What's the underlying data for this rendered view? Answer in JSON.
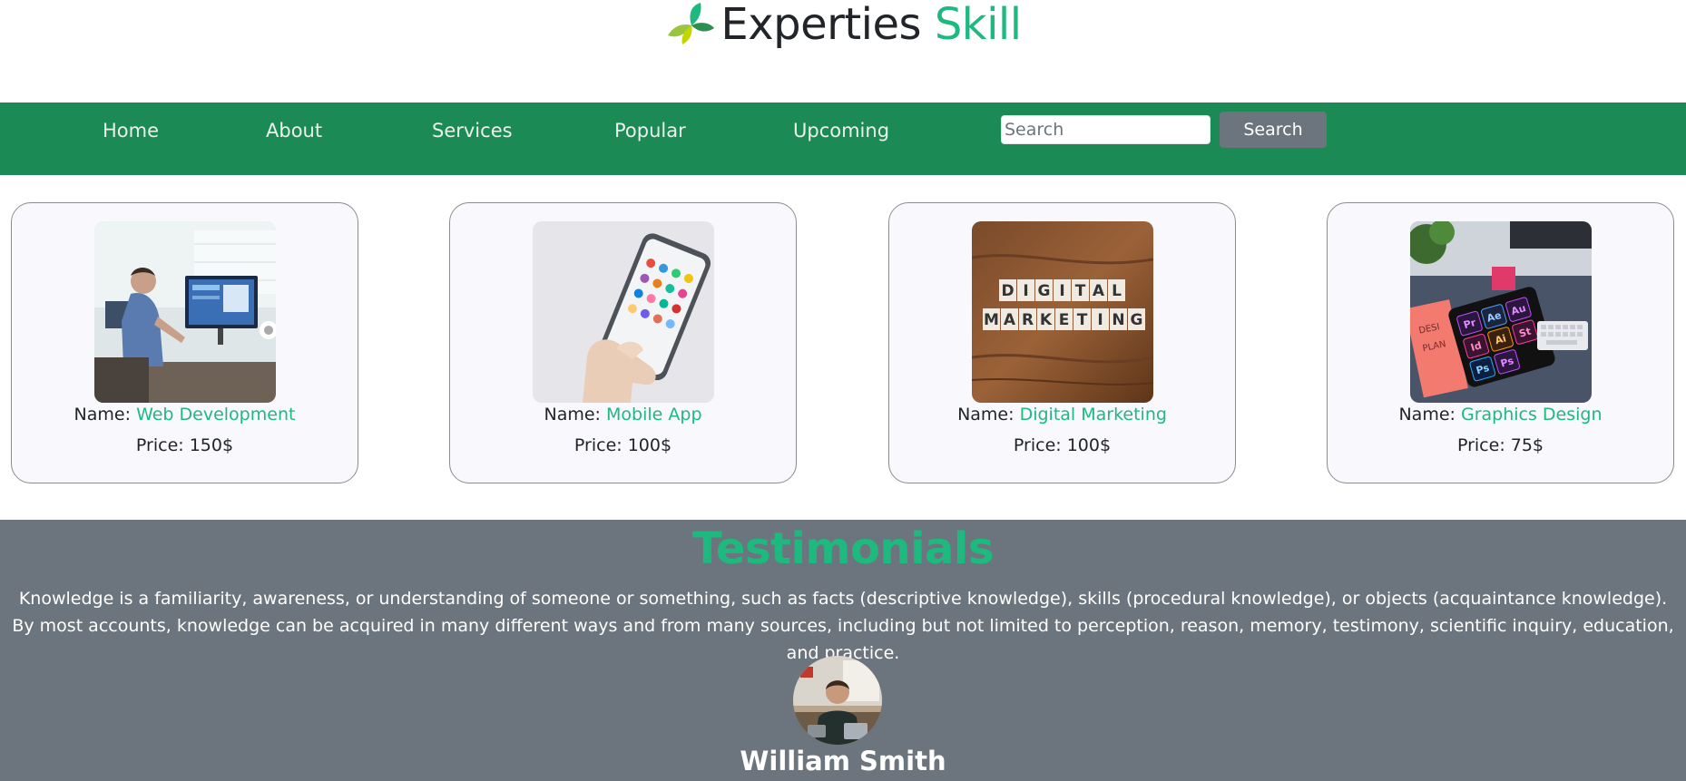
{
  "brand": {
    "title_part1": "Experties",
    "title_part2": "Skill",
    "accent_color": "#1db97f"
  },
  "nav": {
    "items": [
      "Home",
      "About",
      "Services",
      "Popular",
      "Upcoming"
    ],
    "search_placeholder": "Search",
    "search_button": "Search",
    "bar_color": "#1b8a55"
  },
  "cards": [
    {
      "name_label": "Name:",
      "name": "Web Development",
      "price": "Price: 150$",
      "image": "person-at-desk-computer"
    },
    {
      "name_label": "Name:",
      "name": "Mobile App",
      "price": "Price: 100$",
      "image": "hand-holding-smartphone"
    },
    {
      "name_label": "Name:",
      "name": "Digital Marketing",
      "price": "Price: 100$",
      "image": "digital-marketing-tiles"
    },
    {
      "name_label": "Name:",
      "name": "Graphics Design",
      "price": "Price: 75$",
      "image": "adobe-tablet-desk"
    }
  ],
  "testimonials": {
    "title": "Testimonials",
    "text": "Knowledge is a familiarity, awareness, or understanding of someone or something, such as facts (descriptive knowledge), skills (procedural knowledge), or objects (acquaintance knowledge). By most accounts, knowledge can be acquired in many different ways and from many sources, including but not limited to perception, reason, memory, testimony, scientific inquiry, education, and practice.",
    "person_name": "William Smith",
    "background_color": "#6c757d"
  }
}
